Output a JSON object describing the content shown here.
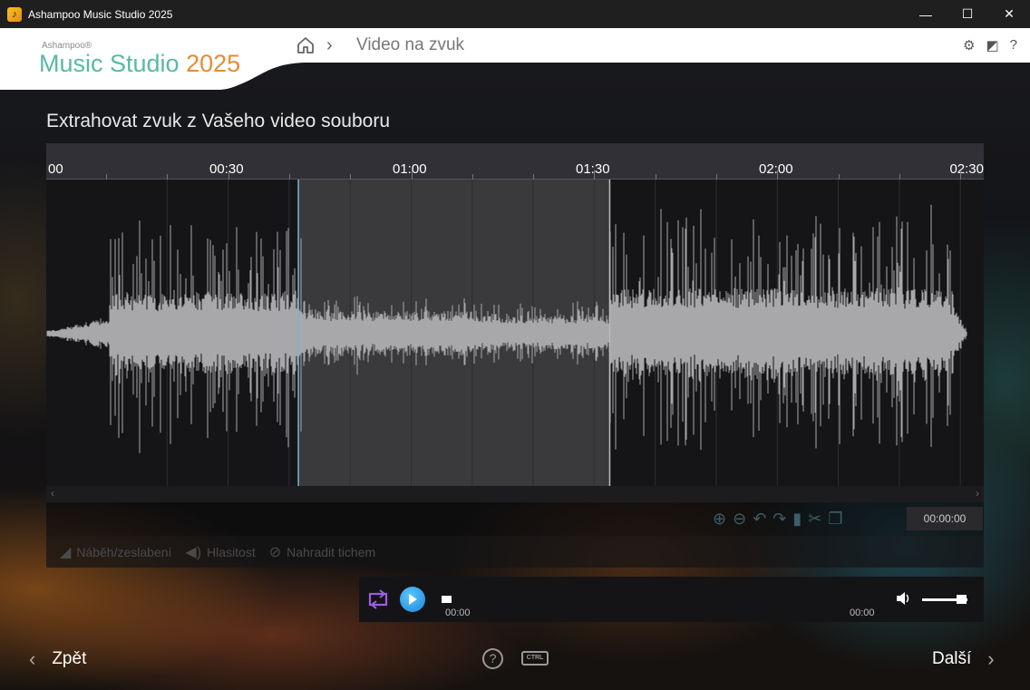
{
  "window": {
    "title": "Ashampoo Music Studio 2025",
    "minimize_glyph": "—",
    "maximize_glyph": "☐",
    "close_glyph": "✕"
  },
  "brand": {
    "small": "Ashampoo®",
    "name": "Music Studio ",
    "year": "2025",
    "name_color": "#58b9a6",
    "year_color": "#e48c33"
  },
  "breadcrumb": {
    "separator": "›",
    "label": "Video na zvuk"
  },
  "header_icons": {
    "settings": "⚙",
    "skin": "◩",
    "help": "?"
  },
  "page": {
    "title": "Extrahovat zvuk z Vašeho video souboru"
  },
  "timeline": {
    "ticks": [
      "00",
      "00:30",
      "01:00",
      "01:30",
      "02:00",
      "02:30"
    ],
    "duration_seconds": 154,
    "selection_start_seconds": 41,
    "selection_end_seconds": 92
  },
  "scrollbar": {
    "left_arrow": "‹",
    "right_arrow": "›"
  },
  "edit_tools": {
    "icons": [
      "zoom-in-icon",
      "zoom-out-icon",
      "undo-icon",
      "redo-icon",
      "paste-icon",
      "cut-icon",
      "copy-icon"
    ],
    "time_value": "00:00:00"
  },
  "effects": {
    "fade": "Náběh/zeslabení",
    "volume": "Hlasitost",
    "silence": "Nahradit tichem"
  },
  "player": {
    "current_time": "00:00",
    "total_time": "00:00",
    "accent_color": "#9b5de5",
    "play_color": "#1a86d8"
  },
  "footer": {
    "back_label": "Zpět",
    "next_label": "Další",
    "help_glyph": "?",
    "ctrl_label": "CTRL"
  }
}
